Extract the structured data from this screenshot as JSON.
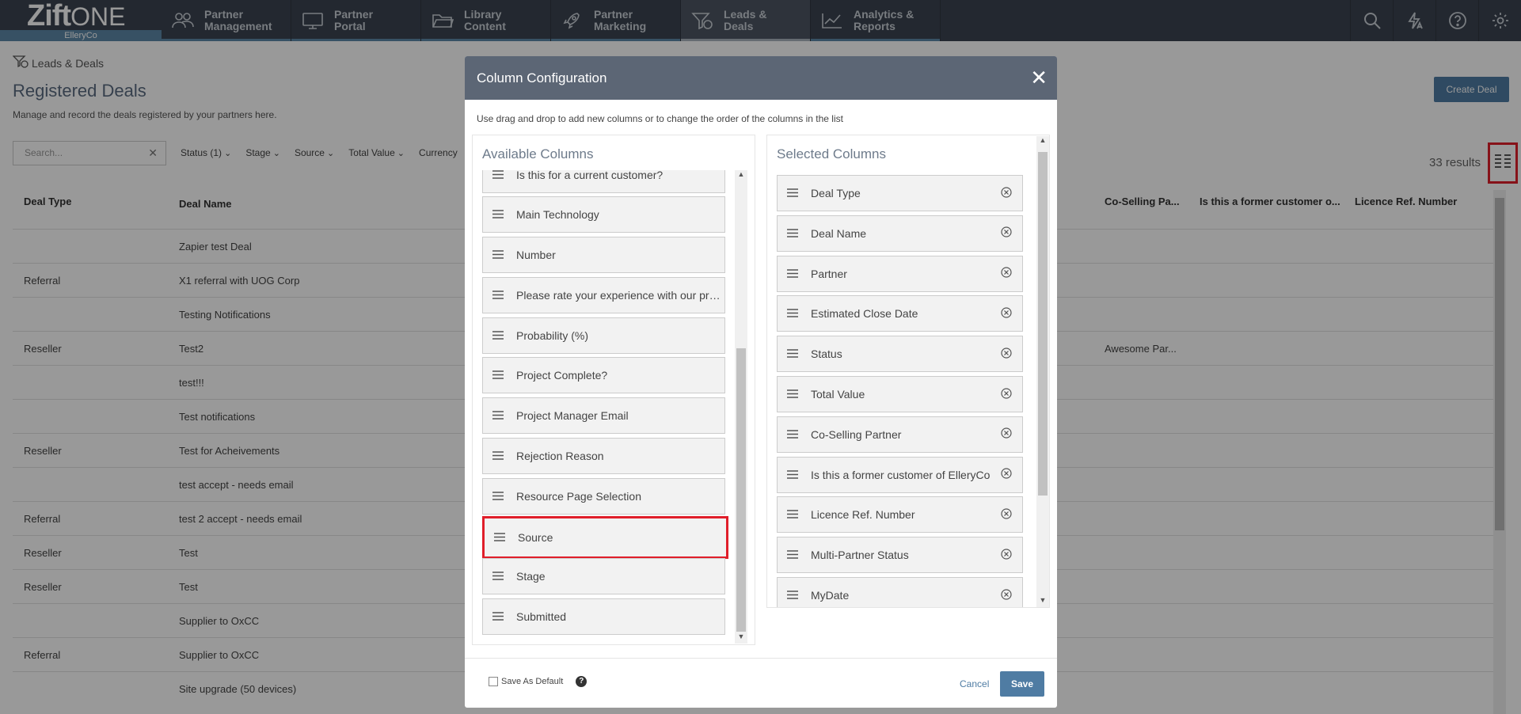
{
  "nav": {
    "brand_bold": "Zift",
    "brand_light": "ONE",
    "company": "ElleryCo",
    "items": [
      {
        "label1": "Partner",
        "label2": "Management"
      },
      {
        "label1": "Partner",
        "label2": "Portal"
      },
      {
        "label1": "Library",
        "label2": "Content"
      },
      {
        "label1": "Partner",
        "label2": "Marketing"
      },
      {
        "label1": "Leads &",
        "label2": "Deals"
      },
      {
        "label1": "Analytics &",
        "label2": "Reports"
      }
    ]
  },
  "page": {
    "breadcrumb": "Leads & Deals",
    "title": "Registered Deals",
    "subtitle": "Manage and record the deals registered by your partners here.",
    "create_label": "Create Deal",
    "search_placeholder": "Search...",
    "filters": [
      "Status (1)",
      "Stage",
      "Source",
      "Total Value",
      "Currency"
    ],
    "results": "33 results"
  },
  "grid": {
    "headers": {
      "deal_type": "Deal Type",
      "deal_name": "Deal Name",
      "co_selling": "Co-Selling Pa...",
      "former_customer": "Is this a former customer o...",
      "licence": "Licence Ref. Number"
    },
    "rows": [
      {
        "type": "",
        "name": "Zapier test Deal",
        "co": ""
      },
      {
        "type": "Referral",
        "name": "X1 referral with UOG Corp",
        "co": ""
      },
      {
        "type": "",
        "name": "Testing Notifications",
        "co": ""
      },
      {
        "type": "Reseller",
        "name": "Test2",
        "co": "Awesome Par..."
      },
      {
        "type": "",
        "name": "test!!!",
        "co": ""
      },
      {
        "type": "",
        "name": "Test notifications",
        "co": ""
      },
      {
        "type": "Reseller",
        "name": "Test for Acheivements",
        "co": ""
      },
      {
        "type": "",
        "name": "test accept - needs email",
        "co": ""
      },
      {
        "type": "Referral",
        "name": "test 2 accept - needs email",
        "co": ""
      },
      {
        "type": "Reseller",
        "name": "Test",
        "co": ""
      },
      {
        "type": "Reseller",
        "name": "Test",
        "co": ""
      },
      {
        "type": "",
        "name": "Supplier to OxCC",
        "co": ""
      },
      {
        "type": "Referral",
        "name": "Supplier to OxCC",
        "co": ""
      },
      {
        "type": "",
        "name": "Site upgrade (50 devices)",
        "co": ""
      }
    ]
  },
  "modal": {
    "title": "Column Configuration",
    "instructions": "Use drag and drop to add new columns or to change the order of the columns in the list",
    "available_title": "Available Columns",
    "selected_title": "Selected Columns",
    "available": [
      "Is this for a current customer?",
      "Main Technology",
      "Number",
      "Please rate your experience with our products",
      "Probability (%)",
      "Project Complete?",
      "Project Manager Email",
      "Rejection Reason",
      "Resource Page Selection",
      "Source",
      "Stage",
      "Submitted"
    ],
    "selected": [
      "Deal Type",
      "Deal Name",
      "Partner",
      "Estimated Close Date",
      "Status",
      "Total Value",
      "Co-Selling Partner",
      "Is this a former customer of ElleryCo",
      "Licence Ref. Number",
      "Multi-Partner Status",
      "MyDate"
    ],
    "save_default_label": "Save As Default",
    "cancel_label": "Cancel",
    "save_label": "Save"
  },
  "colors": {
    "nav_bg": "#3b4350",
    "accent": "#4f7ca3",
    "highlight": "#e01e2a",
    "modal_header": "#5c6675"
  }
}
